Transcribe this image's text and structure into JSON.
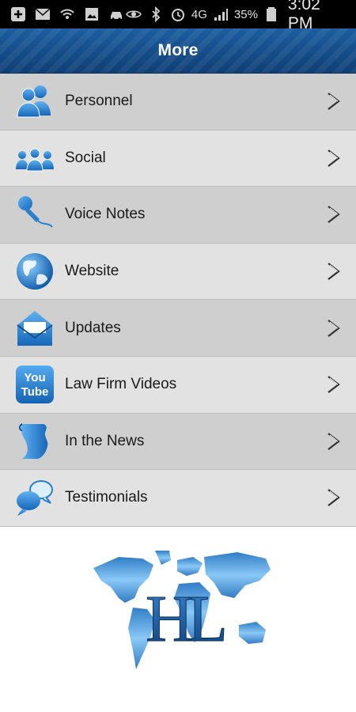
{
  "status_bar": {
    "battery_percent": "35%",
    "time": "3:02 PM",
    "signal_label": "4G",
    "icons": [
      "add-icon",
      "mail-icon",
      "wifi-hotspot-icon",
      "image-icon",
      "car-icon",
      "eye-icon",
      "bluetooth-icon",
      "alarm-icon",
      "signal-icon",
      "battery-icon"
    ]
  },
  "header": {
    "title": "More"
  },
  "menu": {
    "items": [
      {
        "label": "Personnel",
        "icon": "personnel-icon"
      },
      {
        "label": "Social",
        "icon": "social-icon"
      },
      {
        "label": "Voice Notes",
        "icon": "microphone-icon"
      },
      {
        "label": "Website",
        "icon": "globe-icon"
      },
      {
        "label": "Updates",
        "icon": "envelope-icon"
      },
      {
        "label": "Law Firm Videos",
        "icon": "youtube-icon",
        "icon_text_1": "You",
        "icon_text_2": "Tube"
      },
      {
        "label": "In the News",
        "icon": "scroll-icon"
      },
      {
        "label": "Testimonials",
        "icon": "speech-bubbles-icon"
      }
    ]
  },
  "logo": {
    "monogram": "HL"
  },
  "colors": {
    "accent": "#1a6fc0",
    "header": "#134a86",
    "row_dark": "#cfcfcf",
    "row_light": "#e2e2e2"
  }
}
